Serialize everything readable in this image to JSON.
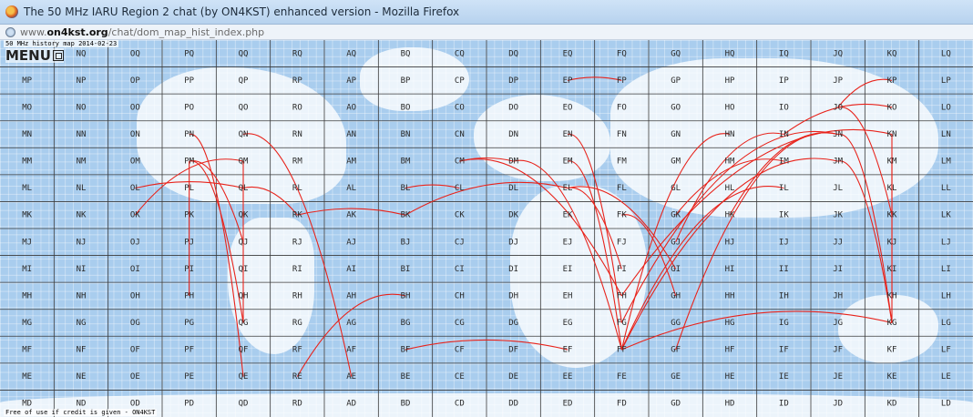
{
  "window": {
    "title": "The 50 MHz IARU Region 2 chat (by ON4KST) enhanced version - Mozilla Firefox",
    "icon": "firefox-icon"
  },
  "urlbar": {
    "icon": "globe-icon",
    "url_prefix": "www.",
    "url_domain": "on4kst.org",
    "url_path": "/chat/dom_map_hist_index.php"
  },
  "map": {
    "history_label": "50 MHz history map 2014-02-23",
    "menu_label": "MENU",
    "footer_credit": "Free of use if credit is given - ON4KST",
    "colors": {
      "ocean": "#a9cdee",
      "land": "#ffffff",
      "path": "#e8231b",
      "grid": "#3a3a3a"
    },
    "columns": [
      "M",
      "N",
      "O",
      "P",
      "Q",
      "R",
      "A",
      "B",
      "C",
      "D",
      "E",
      "F",
      "G",
      "H",
      "I",
      "J",
      "K",
      "L"
    ],
    "rows": [
      "O",
      "P",
      "O",
      "N",
      "M",
      "L",
      "K",
      "J",
      "I",
      "H",
      "G",
      "F",
      "E",
      "D"
    ],
    "row_labels": [
      [
        "",
        "NQ",
        "OQ",
        "PQ",
        "QQ",
        "RQ",
        "AQ",
        "BQ",
        "CQ",
        "DQ",
        "EQ",
        "FQ",
        "GQ",
        "HQ",
        "IQ",
        "JQ",
        "KQ",
        "LQ"
      ],
      [
        "MP",
        "NP",
        "OP",
        "PP",
        "QP",
        "RP",
        "AP",
        "BP",
        "CP",
        "DP",
        "EP",
        "FP",
        "GP",
        "HP",
        "IP",
        "JP",
        "KP",
        "LP"
      ],
      [
        "MO",
        "NO",
        "OO",
        "PO",
        "QO",
        "RO",
        "AO",
        "BO",
        "CO",
        "DO",
        "EO",
        "FO",
        "GO",
        "HO",
        "IO",
        "JO",
        "KO",
        "LO"
      ],
      [
        "MN",
        "NN",
        "ON",
        "PN",
        "QN",
        "RN",
        "AN",
        "BN",
        "CN",
        "DN",
        "EN",
        "FN",
        "GN",
        "HN",
        "IN",
        "JN",
        "KN",
        "LN"
      ],
      [
        "MM",
        "NM",
        "OM",
        "PM",
        "QM",
        "RM",
        "AM",
        "BM",
        "CM",
        "DM",
        "EM",
        "FM",
        "GM",
        "HM",
        "IM",
        "JM",
        "KM",
        "LM"
      ],
      [
        "ML",
        "NL",
        "OL",
        "PL",
        "QL",
        "RL",
        "AL",
        "BL",
        "CL",
        "DL",
        "EL",
        "FL",
        "GL",
        "HL",
        "IL",
        "JL",
        "KL",
        "LL"
      ],
      [
        "MK",
        "NK",
        "OK",
        "PK",
        "QK",
        "RK",
        "AK",
        "BK",
        "CK",
        "DK",
        "EK",
        "FK",
        "GK",
        "HK",
        "IK",
        "JK",
        "KK",
        "LK"
      ],
      [
        "MJ",
        "NJ",
        "OJ",
        "PJ",
        "QJ",
        "RJ",
        "AJ",
        "BJ",
        "CJ",
        "DJ",
        "EJ",
        "FJ",
        "GJ",
        "HJ",
        "IJ",
        "JJ",
        "KJ",
        "LJ"
      ],
      [
        "MI",
        "NI",
        "OI",
        "PI",
        "QI",
        "RI",
        "AI",
        "BI",
        "CI",
        "DI",
        "EI",
        "FI",
        "GI",
        "HI",
        "II",
        "JI",
        "KI",
        "LI"
      ],
      [
        "MH",
        "NH",
        "OH",
        "PH",
        "QH",
        "RH",
        "AH",
        "BH",
        "CH",
        "DH",
        "EH",
        "FH",
        "GH",
        "HH",
        "IH",
        "JH",
        "KH",
        "LH"
      ],
      [
        "MG",
        "NG",
        "OG",
        "PG",
        "QG",
        "RG",
        "AG",
        "BG",
        "CG",
        "DG",
        "EG",
        "FG",
        "GG",
        "HG",
        "IG",
        "JG",
        "KG",
        "LG"
      ],
      [
        "MF",
        "NF",
        "OF",
        "PF",
        "QF",
        "RF",
        "AF",
        "BF",
        "CF",
        "DF",
        "EF",
        "FF",
        "GF",
        "HF",
        "IF",
        "JF",
        "KF",
        "LF"
      ],
      [
        "ME",
        "NE",
        "OE",
        "PE",
        "QE",
        "RE",
        "AE",
        "BE",
        "CE",
        "DE",
        "EE",
        "FE",
        "GE",
        "HE",
        "IE",
        "JE",
        "KE",
        "LE"
      ],
      [
        "MD",
        "ND",
        "OD",
        "PD",
        "QD",
        "RD",
        "AD",
        "BD",
        "CD",
        "DD",
        "ED",
        "FD",
        "GD",
        "HD",
        "ID",
        "JD",
        "KD",
        "LD"
      ]
    ],
    "qso_paths": [
      {
        "from": "PM",
        "to": "QG"
      },
      {
        "from": "PM",
        "to": "PH"
      },
      {
        "from": "QM",
        "to": "QG"
      },
      {
        "from": "PM",
        "to": "QJ"
      },
      {
        "from": "OK",
        "to": "QM"
      },
      {
        "from": "QL",
        "to": "RK"
      },
      {
        "from": "OL",
        "to": "QL"
      },
      {
        "from": "BK",
        "to": "EL"
      },
      {
        "from": "CM",
        "to": "FH"
      },
      {
        "from": "DM",
        "to": "FF"
      },
      {
        "from": "EM",
        "to": "FF"
      },
      {
        "from": "EN",
        "to": "FG"
      },
      {
        "from": "FF",
        "to": "JM"
      },
      {
        "from": "GF",
        "to": "JN"
      },
      {
        "from": "FF",
        "to": "IL"
      },
      {
        "from": "JN",
        "to": "KG"
      },
      {
        "from": "JM",
        "to": "KG"
      },
      {
        "from": "KN",
        "to": "KG"
      },
      {
        "from": "KM",
        "to": "KH"
      },
      {
        "from": "JO",
        "to": "KK"
      },
      {
        "from": "BL",
        "to": "CL"
      },
      {
        "from": "CM",
        "to": "DM"
      },
      {
        "from": "GK",
        "to": "IM"
      },
      {
        "from": "EL",
        "to": "GI"
      },
      {
        "from": "FG",
        "to": "JN"
      },
      {
        "from": "RK",
        "to": "BK"
      },
      {
        "from": "PN",
        "to": "QE"
      },
      {
        "from": "QN",
        "to": "AE"
      },
      {
        "from": "RE",
        "to": "BH"
      },
      {
        "from": "BF",
        "to": "EF"
      },
      {
        "from": "EP",
        "to": "FP"
      },
      {
        "from": "IN",
        "to": "KO"
      },
      {
        "from": "JO",
        "to": "KP"
      },
      {
        "from": "HK",
        "to": "JN"
      },
      {
        "from": "GJ",
        "to": "IN"
      },
      {
        "from": "FH",
        "to": "KN"
      },
      {
        "from": "FF",
        "to": "KG"
      },
      {
        "from": "FF",
        "to": "HN"
      },
      {
        "from": "EL",
        "to": "FI"
      },
      {
        "from": "FK",
        "to": "GH"
      }
    ]
  }
}
